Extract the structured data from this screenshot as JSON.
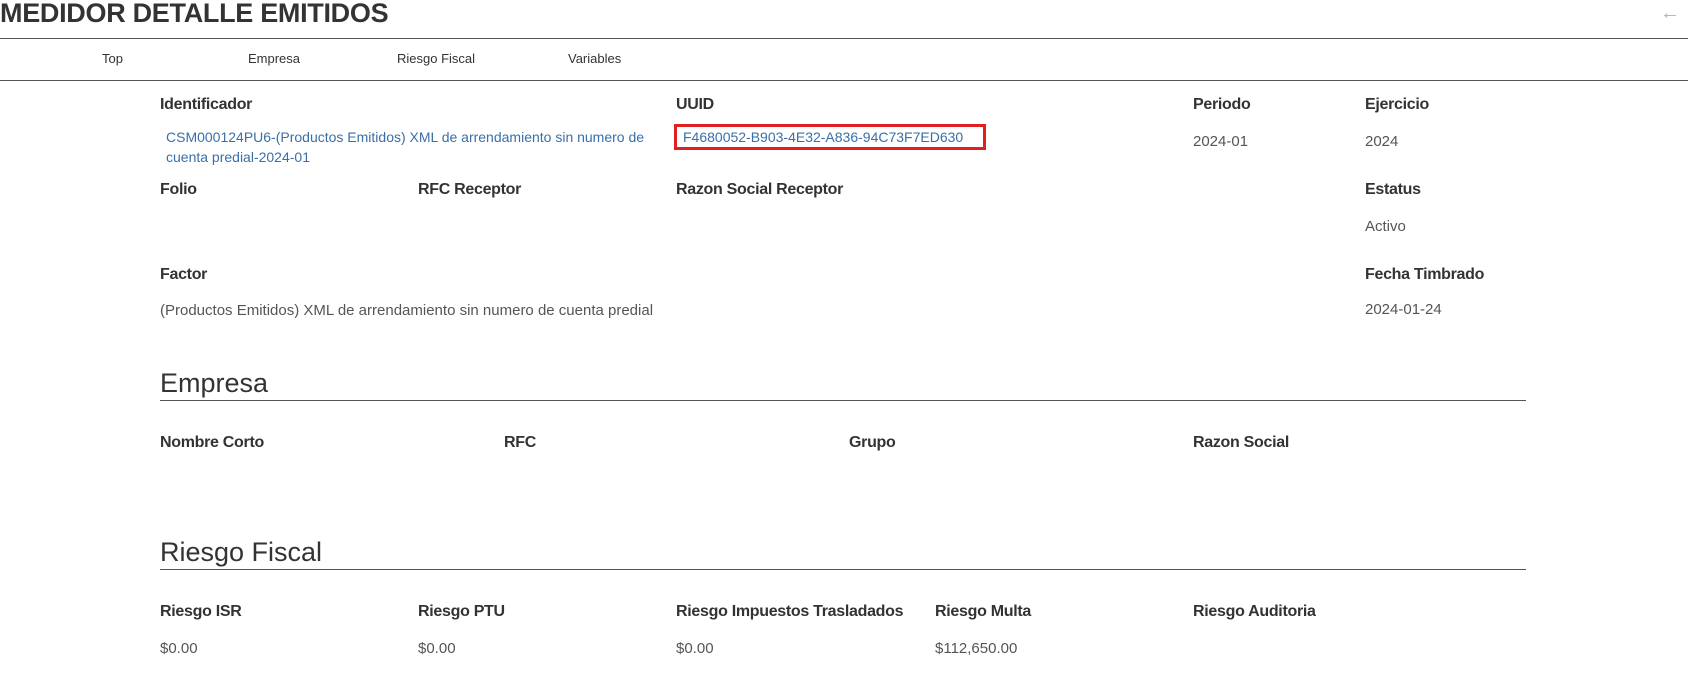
{
  "header": {
    "title": "MEDIDOR DETALLE EMITIDOS",
    "back_icon": "arrow-left-icon"
  },
  "nav": {
    "tabs": [
      "Top",
      "Empresa",
      "Riesgo Fiscal",
      "Variables"
    ]
  },
  "top": {
    "labels": {
      "identificador": "Identificador",
      "uuid": "UUID",
      "periodo": "Periodo",
      "ejercicio": "Ejercicio",
      "folio": "Folio",
      "rfc_receptor": "RFC Receptor",
      "razon_social_receptor": "Razon Social Receptor",
      "estatus": "Estatus",
      "factor": "Factor",
      "fecha_timbrado": "Fecha Timbrado"
    },
    "values": {
      "identificador": "CSM000124PU6-(Productos Emitidos) XML de arrendamiento sin numero de cuenta predial-2024-01",
      "uuid": "F4680052-B903-4E32-A836-94C73F7ED630",
      "periodo": "2024-01",
      "ejercicio": "2024",
      "estatus": "Activo",
      "factor": "(Productos Emitidos) XML de arrendamiento sin numero de cuenta predial",
      "fecha_timbrado": "2024-01-24"
    }
  },
  "empresa": {
    "title": "Empresa",
    "labels": {
      "nombre_corto": "Nombre Corto",
      "rfc": "RFC",
      "grupo": "Grupo",
      "razon_social": "Razon Social"
    }
  },
  "riesgo": {
    "title": "Riesgo Fiscal",
    "labels": {
      "isr": "Riesgo ISR",
      "ptu": "Riesgo PTU",
      "impuestos": "Riesgo Impuestos Trasladados",
      "multa": "Riesgo Multa",
      "auditoria": "Riesgo Auditoria"
    },
    "values": {
      "isr": "$0.00",
      "ptu": "$0.00",
      "impuestos": "$0.00",
      "multa": "$112,650.00"
    }
  }
}
